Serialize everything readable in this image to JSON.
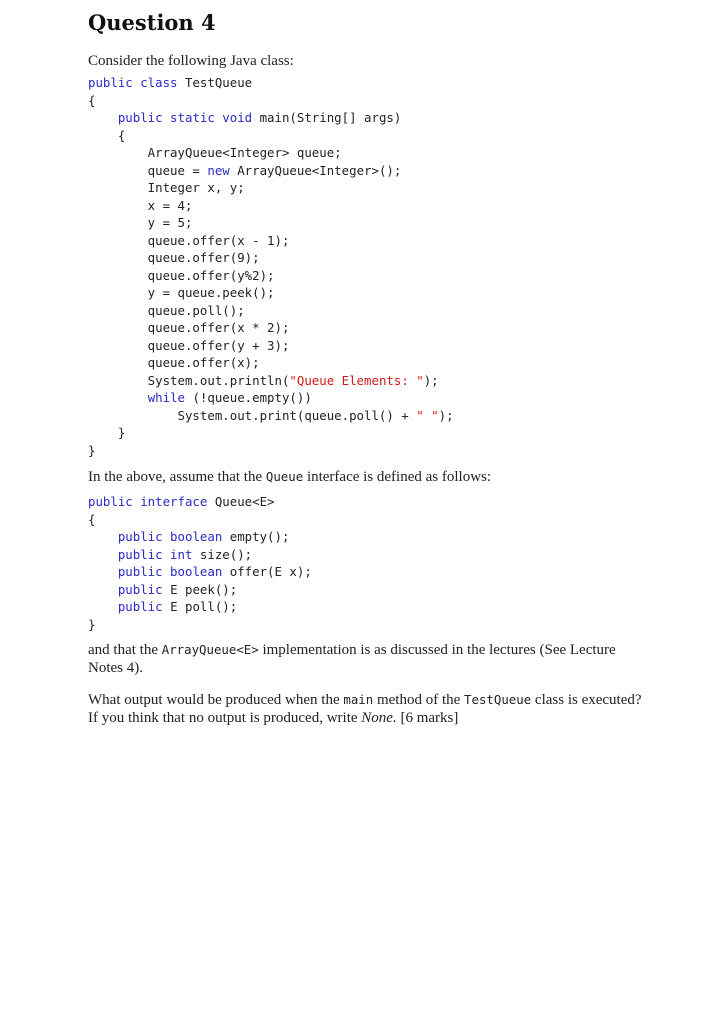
{
  "question": {
    "title": "Question 4",
    "intro": "Consider the following Java class:",
    "class_code": [
      [
        {
          "t": "public class",
          "k": "kw"
        },
        {
          "t": " TestQueue"
        }
      ],
      [
        {
          "t": "{"
        }
      ],
      [
        {
          "t": "    "
        },
        {
          "t": "public static void",
          "k": "kw"
        },
        {
          "t": " main(String[] args)"
        }
      ],
      [
        {
          "t": "    {"
        }
      ],
      [
        {
          "t": "        ArrayQueue<Integer> queue;"
        }
      ],
      [
        {
          "t": "        queue = "
        },
        {
          "t": "new",
          "k": "kw"
        },
        {
          "t": " ArrayQueue<Integer>();"
        }
      ],
      [
        {
          "t": "        Integer x, y;"
        }
      ],
      [
        {
          "t": "        x = 4;"
        }
      ],
      [
        {
          "t": "        y = 5;"
        }
      ],
      [
        {
          "t": "        queue.offer(x - 1);"
        }
      ],
      [
        {
          "t": "        queue.offer(9);"
        }
      ],
      [
        {
          "t": "        queue.offer(y%2);"
        }
      ],
      [
        {
          "t": "        y = queue.peek();"
        }
      ],
      [
        {
          "t": "        queue.poll();"
        }
      ],
      [
        {
          "t": "        queue.offer(x * 2);"
        }
      ],
      [
        {
          "t": "        queue.offer(y + 3);"
        }
      ],
      [
        {
          "t": "        queue.offer(x);"
        }
      ],
      [
        {
          "t": "        System.out.println("
        },
        {
          "t": "\"Queue Elements: \"",
          "k": "str"
        },
        {
          "t": ");"
        }
      ],
      [
        {
          "t": "        "
        },
        {
          "t": "while",
          "k": "kw"
        },
        {
          "t": " (!queue.empty())"
        }
      ],
      [
        {
          "t": "            System.out.print(queue.poll() + "
        },
        {
          "t": "\" \"",
          "k": "str"
        },
        {
          "t": ");"
        }
      ],
      [
        {
          "t": "    }"
        }
      ],
      [
        {
          "t": "}"
        }
      ]
    ],
    "interface_intro": {
      "before": "In the above, assume that the ",
      "code": "Queue",
      "after": " interface is defined as follows:"
    },
    "interface_code": [
      [
        {
          "t": "public interface",
          "k": "kw"
        },
        {
          "t": " Queue<E>"
        }
      ],
      [
        {
          "t": "{"
        }
      ],
      [
        {
          "t": "    "
        },
        {
          "t": "public boolean",
          "k": "kw"
        },
        {
          "t": " empty();"
        }
      ],
      [
        {
          "t": "    "
        },
        {
          "t": "public int",
          "k": "kw"
        },
        {
          "t": " size();"
        }
      ],
      [
        {
          "t": "    "
        },
        {
          "t": "public boolean",
          "k": "kw"
        },
        {
          "t": " offer(E x);"
        }
      ],
      [
        {
          "t": "    "
        },
        {
          "t": "public",
          "k": "kw"
        },
        {
          "t": " E peek();"
        }
      ],
      [
        {
          "t": "    "
        },
        {
          "t": "public",
          "k": "kw"
        },
        {
          "t": " E poll();"
        }
      ],
      [
        {
          "t": "}"
        }
      ]
    ],
    "impl_note": {
      "before": "and that the ",
      "code": "ArrayQueue<E>",
      "after": " implementation is as discussed in the lectures (See Lecture Notes 4)."
    },
    "prompt": {
      "p1": "What output would be produced when the ",
      "c1": "main",
      "p2": " method of the ",
      "c2": "TestQueue",
      "p3": " class is executed? If you think that no output is produced, write ",
      "none": "None.",
      "marks": " [6 marks]"
    }
  }
}
